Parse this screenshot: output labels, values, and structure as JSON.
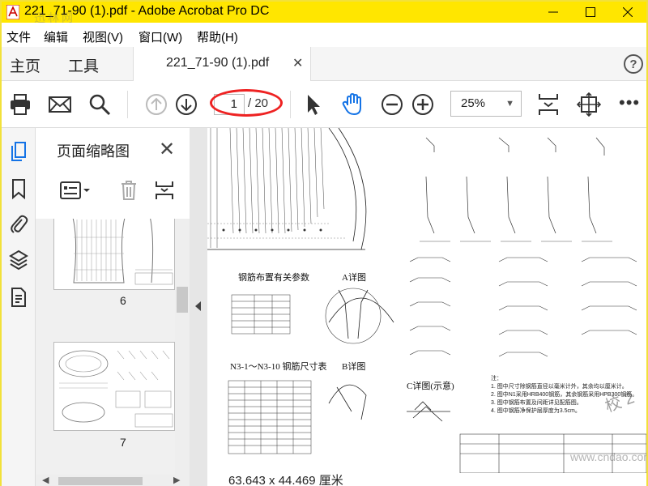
{
  "window": {
    "title": "221_71-90 (1).pdf - Adobe Acrobat Pro DC",
    "watermark": "迅林网"
  },
  "menu": [
    "文件",
    "编辑",
    "视图(V)",
    "窗口(W)",
    "帮助(H)"
  ],
  "tabs": {
    "home": "主页",
    "tools": "工具",
    "document": "221_71-90 (1).pdf",
    "help": "?"
  },
  "toolbar": {
    "current_page": "1",
    "total_pages": "/ 20",
    "zoom": "25%",
    "more": "•••"
  },
  "thumbnails": {
    "title": "页面缩略图",
    "items": [
      {
        "page_label": "6"
      },
      {
        "page_label": "7"
      }
    ]
  },
  "document": {
    "texts": {
      "table1_title": "钢筋布置有关参数",
      "detail_a": "A详图",
      "table2_title": "N3-1～N3-10 钢筋尺寸表",
      "detail_b": "B详图",
      "detail_c": "C详图(示意)",
      "notes_title": "注：",
      "note1": "1. 图中尺寸除钢筋直径以毫米计外，其余均以厘米计。",
      "note2": "2. 图中N1采用HRB400钢筋，其余钢筋采用HPB300钢筋。",
      "note3": "3. 图中钢筋布置及间距详见配筋图。",
      "note4": "4. 图中钢筋净保护层厚度为3.5cm。",
      "stamp": "校 2",
      "site_watermark": "www.cndao.com"
    }
  },
  "status": {
    "dimensions": "63.643 x 44.469 厘米"
  },
  "colors": {
    "titlebar": "#ffe600",
    "accent_blue": "#1473e6",
    "annotation_red": "#e22222"
  }
}
